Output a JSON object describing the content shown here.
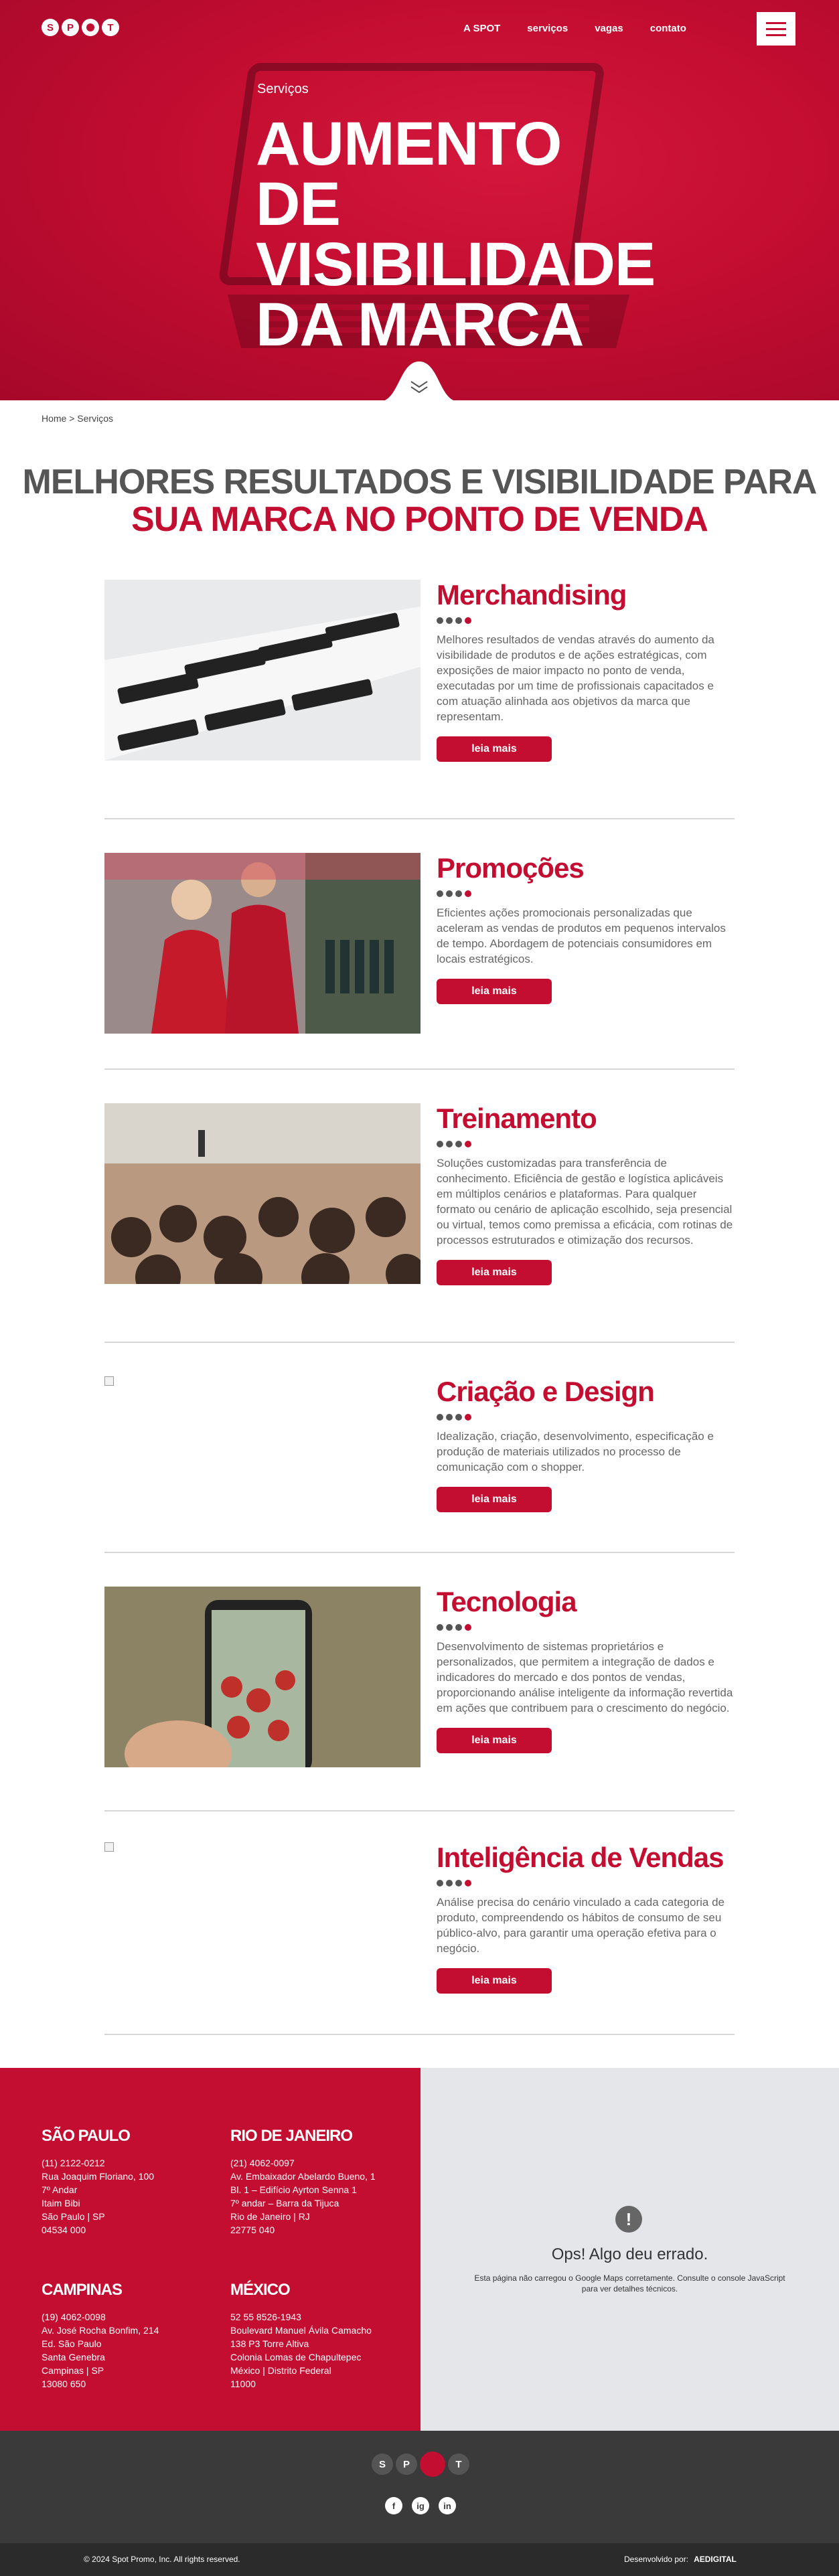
{
  "brand": {
    "logo": "SPOT"
  },
  "nav": [
    "A SPOT",
    "serviços",
    "vagas",
    "contato"
  ],
  "hero": {
    "subtitle": "Serviços",
    "title": "AUMENTO DE VISIBILIDADE DA MARCA"
  },
  "breadcrumb": "Home > Serviços",
  "heading": {
    "line1": "MELHORES RESULTADOS E VISIBILIDADE PARA",
    "line2": "SUA MARCA NO PONTO DE VENDA"
  },
  "services": [
    {
      "title": "Merchandising",
      "text": "Melhores resultados de vendas através do aumento da visibilidade de produtos e de ações estratégicas, com exposições de maior impacto no ponto de venda, executadas por um time de profissionais capacitados e com atuação alinhada aos objetivos da marca que representam.",
      "button": "leia mais"
    },
    {
      "title": "Promoções",
      "text": "Eficientes ações promocionais personalizadas que aceleram as vendas de produtos em pequenos intervalos de tempo. Abordagem de potenciais consumidores em locais estratégicos.",
      "button": "leia mais"
    },
    {
      "title": "Treinamento",
      "text": "Soluções customizadas para transferência de conhecimento. Eficiência de gestão e logística aplicáveis em múltiplos cenários e plataformas. Para qualquer formato ou cenário de aplicação escolhido, seja presencial ou virtual, temos como premissa a eficácia, com rotinas de processos estruturados e otimização dos recursos.",
      "button": "leia mais"
    },
    {
      "title": "Criação e Design",
      "text": "Idealização, criação, desenvolvimento, especificação e produção de materiais utilizados no processo de comunicação com o shopper.",
      "button": "leia mais"
    },
    {
      "title": "Tecnologia",
      "text": "Desenvolvimento de sistemas proprietários e personalizados, que permitem a integração de dados e indicadores do mercado e dos pontos de vendas, proporcionando análise inteligente da informação revertida em ações que contribuem para o crescimento do negócio.",
      "button": "leia mais"
    },
    {
      "title": "Inteligência de Vendas",
      "text": "Análise precisa do cenário vinculado a cada categoria de produto, compreendendo os hábitos de consumo de seu público-alvo, para garantir uma operação efetiva para o negócio.",
      "button": "leia mais"
    }
  ],
  "offices": [
    {
      "city": "SÃO PAULO",
      "lines": [
        "(11) 2122-0212",
        "Rua Joaquim Floriano, 100",
        "7º Andar",
        "Itaim Bibi",
        "São Paulo | SP",
        "04534 000"
      ]
    },
    {
      "city": "RIO DE JANEIRO",
      "lines": [
        "(21) 4062-0097",
        "Av. Embaixador Abelardo Bueno, 1",
        "Bl. 1 – Edifício Ayrton Senna 1",
        "7º andar – Barra da Tijuca",
        "Rio de Janeiro | RJ",
        "22775 040"
      ]
    },
    {
      "city": "CAMPINAS",
      "lines": [
        "(19) 4062-0098",
        "Av. José Rocha Bonfim, 214",
        "Ed. São Paulo",
        "Santa Genebra",
        "Campinas | SP",
        "13080 650"
      ]
    },
    {
      "city": "MÉXICO",
      "lines": [
        "52 55 8526-1943",
        "Boulevard Manuel Ávila Camacho",
        "138 P3 Torre Altiva",
        "Colonia Lomas de Chapultepec",
        "México | Distrito Federal",
        "11000"
      ]
    }
  ],
  "map": {
    "title": "Ops! Algo deu errado.",
    "desc": "Esta página não carregou o Google Maps corretamente. Consulte o console JavaScript para ver detalhes técnicos."
  },
  "social": [
    "f",
    "ig",
    "in"
  ],
  "footer": {
    "copyright": "© 2024 Spot Promo, Inc. All rights reserved.",
    "dev_label": "Desenvolvido por:",
    "dev_name": "AEDIGITAL"
  },
  "colors": {
    "brand_red": "#c30d31",
    "dark": "#3a3a3a"
  }
}
